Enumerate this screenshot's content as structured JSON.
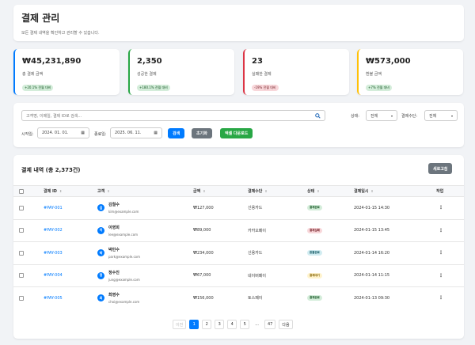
{
  "header": {
    "title": "결제 관리",
    "subtitle": "모든 결제 내역을 확인하고 관리할 수 있습니다."
  },
  "stats": [
    {
      "value": "₩45,231,890",
      "label": "총 결제 금액",
      "badge": "+20.1% 전월 대비",
      "trend": "up",
      "color": "#007bff"
    },
    {
      "value": "2,350",
      "label": "성공한 결제",
      "badge": "+180.1% 전월 대비",
      "trend": "up",
      "color": "#28a745"
    },
    {
      "value": "23",
      "label": "실패한 결제",
      "badge": "-19% 전월 대비",
      "trend": "down",
      "color": "#dc3545"
    },
    {
      "value": "₩573,000",
      "label": "환불 금액",
      "badge": "+7% 전월 대비",
      "trend": "up",
      "color": "#ffc107"
    }
  ],
  "filter": {
    "search_placeholder": "고객명, 이메일, 결제 ID로 검색...",
    "status_label": "상태:",
    "status_value": "전체",
    "method_label": "결제수단:",
    "method_value": "전체",
    "start_label": "시작일:",
    "start_date": "2024. 01. 01.",
    "end_label": "종료일:",
    "end_date": "2025. 06. 11.",
    "search_btn": "검색",
    "reset_btn": "초기화",
    "excel_btn": "엑셀 다운로드"
  },
  "table": {
    "title": "결제 내역 (총 2,373건)",
    "refresh_btn": "새로고침",
    "headers": {
      "id": "결제 ID",
      "customer": "고객",
      "amount": "금액",
      "method": "결제수단",
      "status": "상태",
      "datetime": "결제일시",
      "actions": "작업"
    },
    "rows": [
      {
        "id": "#PAY-001",
        "initial": "김",
        "name": "김철수",
        "email": "kim@example.com",
        "amount": "₩127,000",
        "method": "신용카드",
        "status": "결제완료",
        "status_type": "ok",
        "datetime": "2024-01-15 14:30"
      },
      {
        "id": "#PAY-002",
        "initial": "이",
        "name": "이영희",
        "email": "lee@example.com",
        "amount": "₩89,000",
        "method": "카카오페이",
        "status": "결제실패",
        "status_type": "fail",
        "datetime": "2024-01-15 13:45"
      },
      {
        "id": "#PAY-003",
        "initial": "박",
        "name": "박민수",
        "email": "park@example.com",
        "amount": "₩234,000",
        "method": "신용카드",
        "status": "환불완료",
        "status_type": "refund",
        "datetime": "2024-01-14 16:20"
      },
      {
        "id": "#PAY-004",
        "initial": "정",
        "name": "정수진",
        "email": "jung@example.com",
        "amount": "₩67,000",
        "method": "네이버페이",
        "status": "결제대기",
        "status_type": "wait",
        "datetime": "2024-01-14 11:15"
      },
      {
        "id": "#PAY-005",
        "initial": "최",
        "name": "최영수",
        "email": "choi@example.com",
        "amount": "₩156,000",
        "method": "토스페이",
        "status": "결제완료",
        "status_type": "ok",
        "datetime": "2024-01-13 09:30"
      }
    ],
    "action_glyph": "⋮"
  },
  "pagination": {
    "prev": "이전",
    "pages": [
      "1",
      "2",
      "3",
      "4",
      "5"
    ],
    "ellipsis": "...",
    "last": "47",
    "next": "다음"
  }
}
